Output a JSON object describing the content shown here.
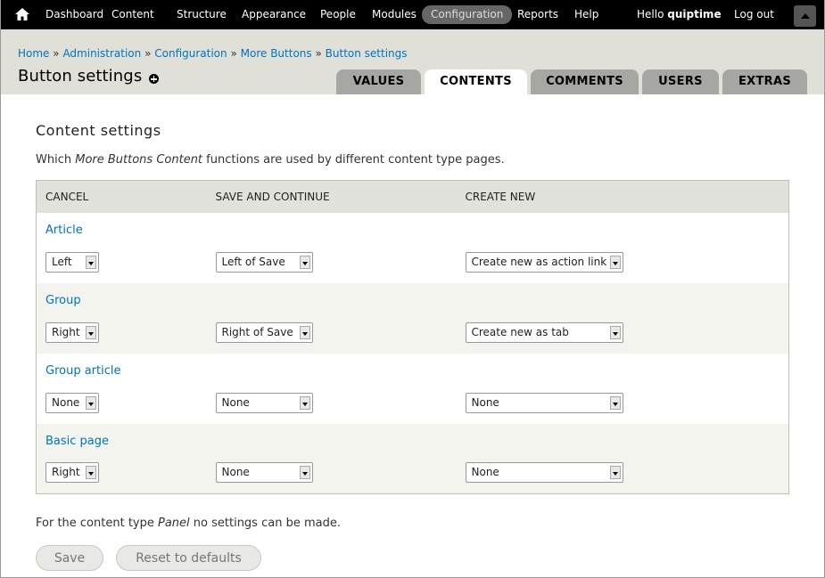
{
  "toolbar": {
    "home_icon": "home-icon",
    "menu": [
      {
        "label": "Dashboard",
        "active": false
      },
      {
        "label": "Content",
        "active": false
      },
      {
        "label": "Structure",
        "active": false
      },
      {
        "label": "Appearance",
        "active": false
      },
      {
        "label": "People",
        "active": false
      },
      {
        "label": "Modules",
        "active": false
      },
      {
        "label": "Configuration",
        "active": true
      },
      {
        "label": "Reports",
        "active": false
      },
      {
        "label": "Help",
        "active": false
      }
    ],
    "hello_prefix": "Hello",
    "username": "quiptime",
    "logout": "Log out",
    "toggle_icon": "triangle-up-icon"
  },
  "breadcrumb": [
    {
      "label": "Home"
    },
    {
      "label": "Administration"
    },
    {
      "label": "Configuration"
    },
    {
      "label": "More Buttons"
    },
    {
      "label": "Button settings"
    }
  ],
  "breadcrumb_separator": "»",
  "page_title": "Button settings",
  "shortcut_icon": "add-shortcut-icon",
  "tabs": [
    {
      "label": "VALUES",
      "active": false
    },
    {
      "label": "CONTENTS",
      "active": true
    },
    {
      "label": "COMMENTS",
      "active": false
    },
    {
      "label": "USERS",
      "active": false
    },
    {
      "label": "EXTRAS",
      "active": false
    }
  ],
  "section_title": "Content settings",
  "description": {
    "before": "Which ",
    "emphasis": "More Buttons Content",
    "after": " functions are used by different content type pages."
  },
  "table": {
    "headers": [
      "CANCEL",
      "SAVE AND CONTINUE",
      "CREATE NEW"
    ],
    "rows": [
      {
        "type": "Article",
        "cancel": "Left",
        "save_continue": "Left of Save",
        "create_new": "Create new as action link"
      },
      {
        "type": "Group",
        "cancel": "Right",
        "save_continue": "Right of Save",
        "create_new": "Create new as tab"
      },
      {
        "type": "Group article",
        "cancel": "None",
        "save_continue": "None",
        "create_new": "None"
      },
      {
        "type": "Basic page",
        "cancel": "Right",
        "save_continue": "None",
        "create_new": "None"
      }
    ]
  },
  "note": {
    "before": "For the content type ",
    "emphasis": "Panel",
    "after": " no settings can be made."
  },
  "buttons": {
    "save": "Save",
    "reset": "Reset to defaults"
  },
  "colors": {
    "toolbar_bg": "#000000",
    "header_bg": "#e0e0d8",
    "link": "#0074bd",
    "tab_inactive": "#a6a7a2",
    "active_menu": "#666666"
  }
}
